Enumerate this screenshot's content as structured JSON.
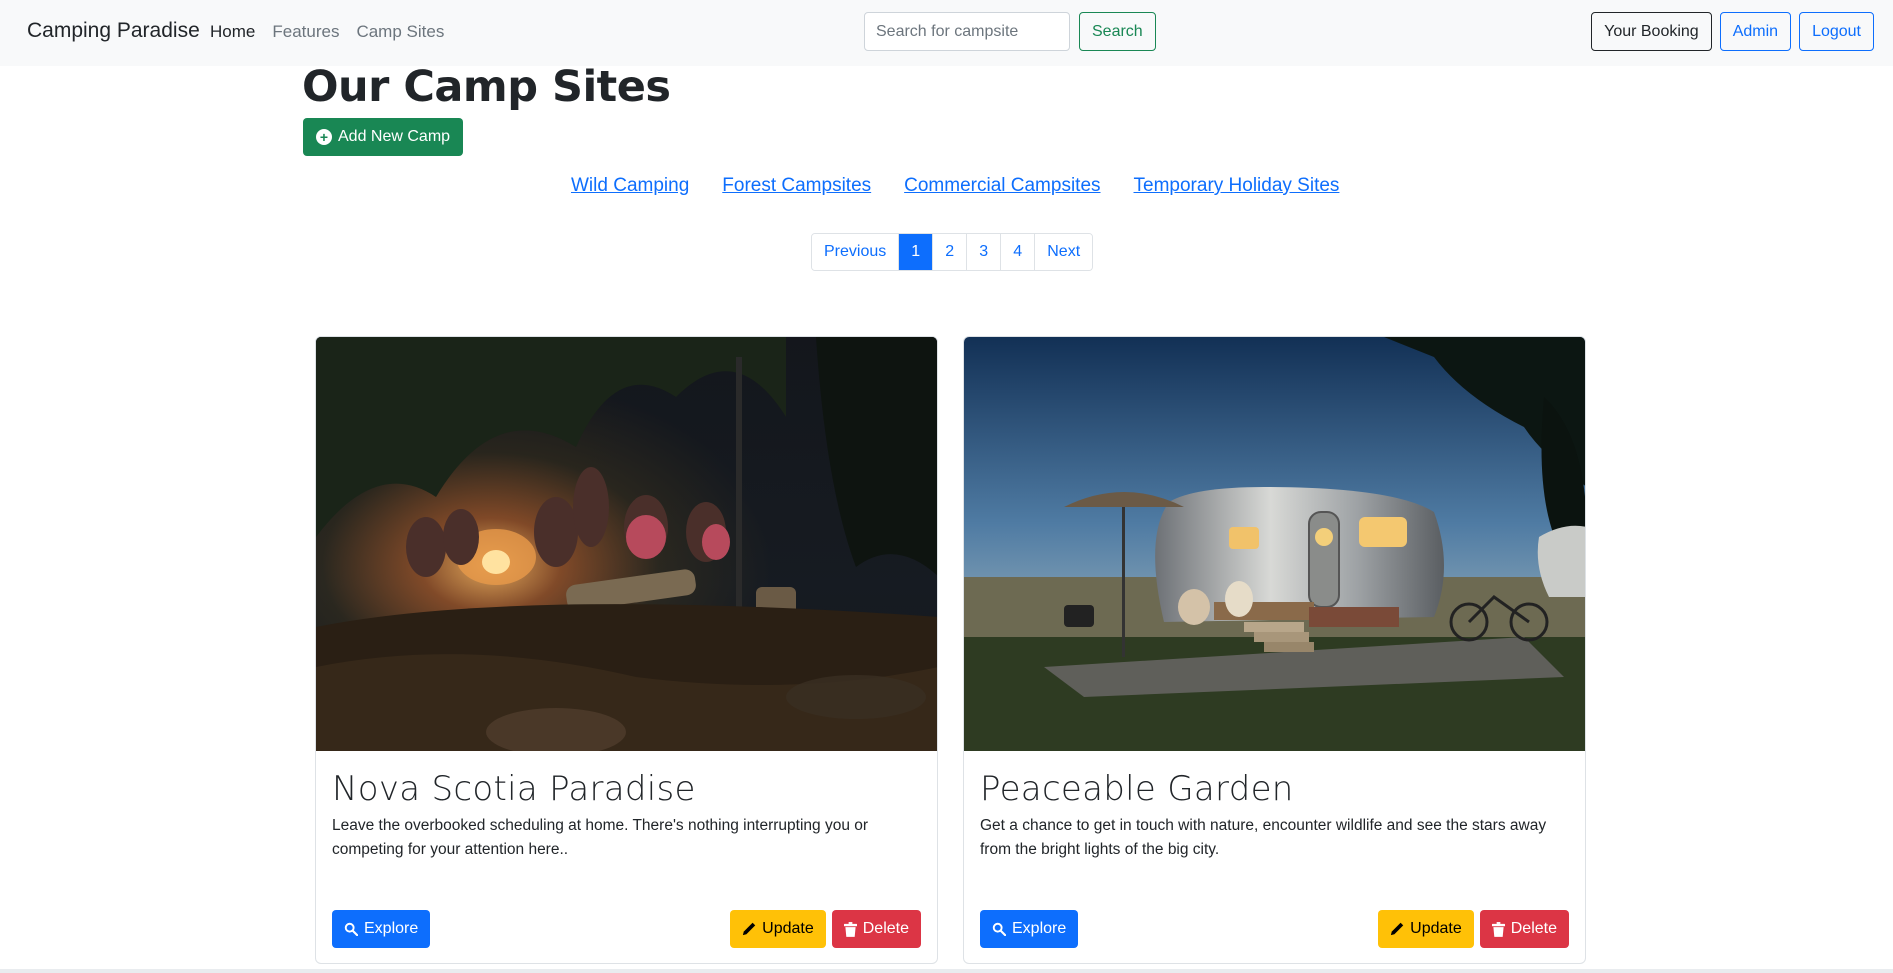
{
  "navbar": {
    "brand": "Camping Paradise",
    "links": [
      "Home",
      "Features",
      "Camp Sites"
    ],
    "search_placeholder": "Search for campsite",
    "search_button": "Search",
    "your_booking": "Your Booking",
    "admin": "Admin",
    "logout": "Logout"
  },
  "main": {
    "title": "Our Camp Sites",
    "add_button": "Add New Camp",
    "categories": [
      "Wild Camping",
      "Forest Campsites",
      "Commercial Campsites",
      "Temporary Holiday Sites"
    ],
    "pagination": {
      "previous": "Previous",
      "pages": [
        "1",
        "2",
        "3",
        "4"
      ],
      "active_page": "1",
      "next": "Next"
    }
  },
  "cards": [
    {
      "title": "Nova Scotia Paradise",
      "text": "Leave the overbooked scheduling at home. There's nothing interrupting you or competing for your attention here..",
      "explore": "Explore",
      "update": "Update",
      "delete": "Delete"
    },
    {
      "title": "Peaceable Garden",
      "text": "Get a chance to get in touch with nature, encounter wildlife and see the stars away from the bright lights of the big city.",
      "explore": "Explore",
      "update": "Update",
      "delete": "Delete"
    }
  ],
  "colors": {
    "primary": "#0d6efd",
    "success": "#198754",
    "warning": "#ffc107",
    "danger": "#dc3545",
    "navbar_bg": "#f8f9fa"
  },
  "icons": {
    "add": "plus-circle-icon",
    "explore": "search-icon",
    "update": "pencil-icon",
    "delete": "trash-icon"
  }
}
